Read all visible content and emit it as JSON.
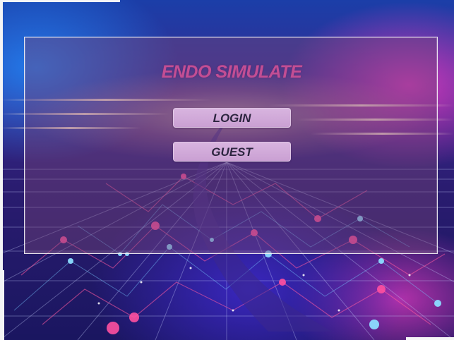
{
  "game": {
    "title": "ENDO SIMULATE"
  },
  "menu": {
    "login_label": "LOGIN",
    "guest_label": "GUEST"
  },
  "colors": {
    "title": "#c24e94",
    "button_bg": "#d8b4df",
    "button_text": "#2d2540",
    "panel_border": "#ffffff"
  }
}
